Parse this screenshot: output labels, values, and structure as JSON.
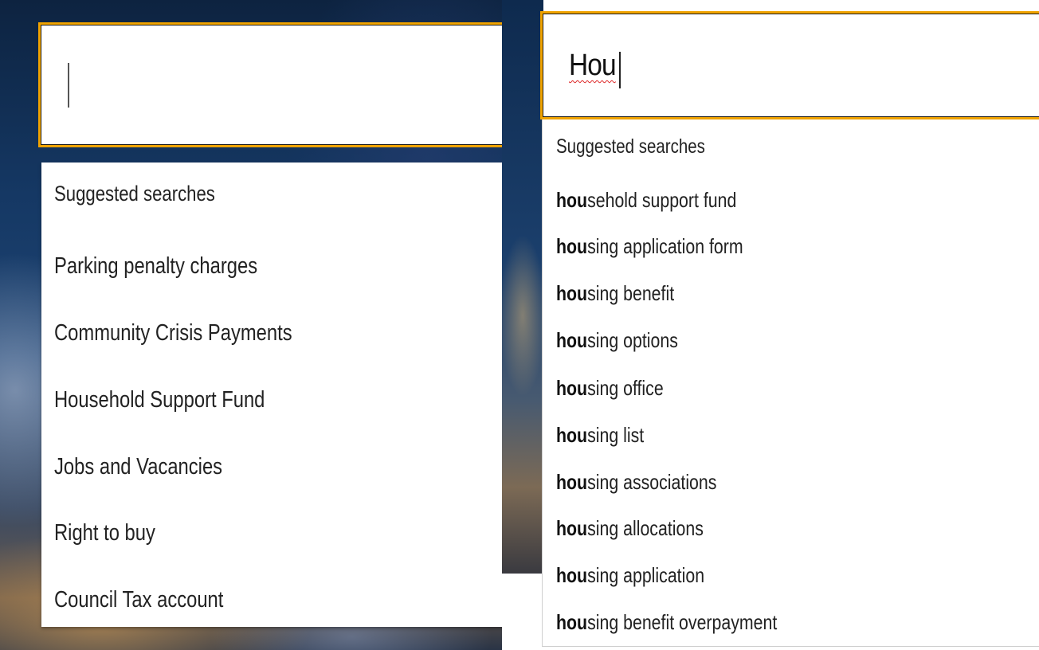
{
  "left": {
    "search_value": "",
    "heading": "Suggested searches",
    "suggestions": [
      "Parking penalty charges",
      "Community Crisis Payments",
      "Household Support Fund",
      "Jobs and Vacancies",
      "Right to buy",
      "Council Tax account"
    ]
  },
  "right": {
    "search_value": "Hou",
    "heading": "Suggested searches",
    "suggestions": [
      {
        "match": "hou",
        "rest": "sehold support fund"
      },
      {
        "match": "hou",
        "rest": "sing application form"
      },
      {
        "match": "hou",
        "rest": "sing benefit"
      },
      {
        "match": "hou",
        "rest": "sing options"
      },
      {
        "match": "hou",
        "rest": "sing office"
      },
      {
        "match": "hou",
        "rest": "sing list"
      },
      {
        "match": "hou",
        "rest": "sing associations"
      },
      {
        "match": "hou",
        "rest": "sing allocations"
      },
      {
        "match": "hou",
        "rest": "sing application"
      },
      {
        "match": "hou",
        "rest": "sing benefit overpayment"
      }
    ]
  },
  "colors": {
    "focus_border": "#f0a300",
    "text": "#222222"
  }
}
